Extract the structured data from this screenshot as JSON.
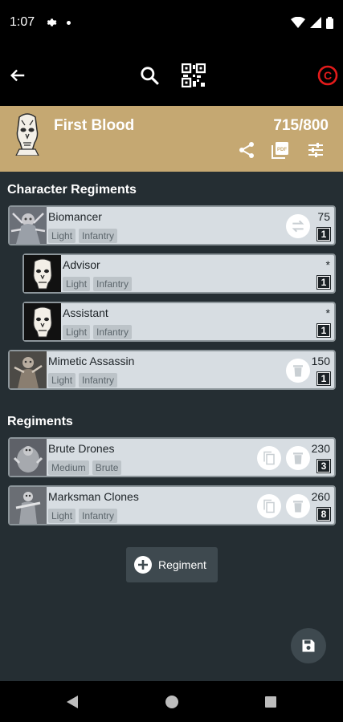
{
  "status_bar": {
    "time": "1:07"
  },
  "app_bar": {
    "icons": [
      "back-arrow-icon",
      "search-icon",
      "qr-code-icon",
      "copyright-icon"
    ],
    "accent": "#e31b1b"
  },
  "army": {
    "title": "First Blood",
    "points": "715/800",
    "header_color": "#c5a872"
  },
  "character_section": {
    "title": "Character Regiments"
  },
  "character_regiments": [
    {
      "name": "Biomancer",
      "tags": [
        "Light",
        "Infantry"
      ],
      "cost": "75",
      "count": "1"
    },
    {
      "name": "Advisor",
      "tags": [
        "Light",
        "Infantry"
      ],
      "cost": "*",
      "count": "1"
    },
    {
      "name": "Assistant",
      "tags": [
        "Light",
        "Infantry"
      ],
      "cost": "*",
      "count": "1"
    },
    {
      "name": "Mimetic Assassin",
      "tags": [
        "Light",
        "Infantry"
      ],
      "cost": "150",
      "count": "1"
    }
  ],
  "regiments_section": {
    "title": "Regiments"
  },
  "regiments": [
    {
      "name": "Brute Drones",
      "tags": [
        "Medium",
        "Brute"
      ],
      "cost": "230",
      "count": "3"
    },
    {
      "name": "Marksman Clones",
      "tags": [
        "Light",
        "Infantry"
      ],
      "cost": "260",
      "count": "8"
    }
  ],
  "add_regiment": {
    "label": "Regiment"
  }
}
